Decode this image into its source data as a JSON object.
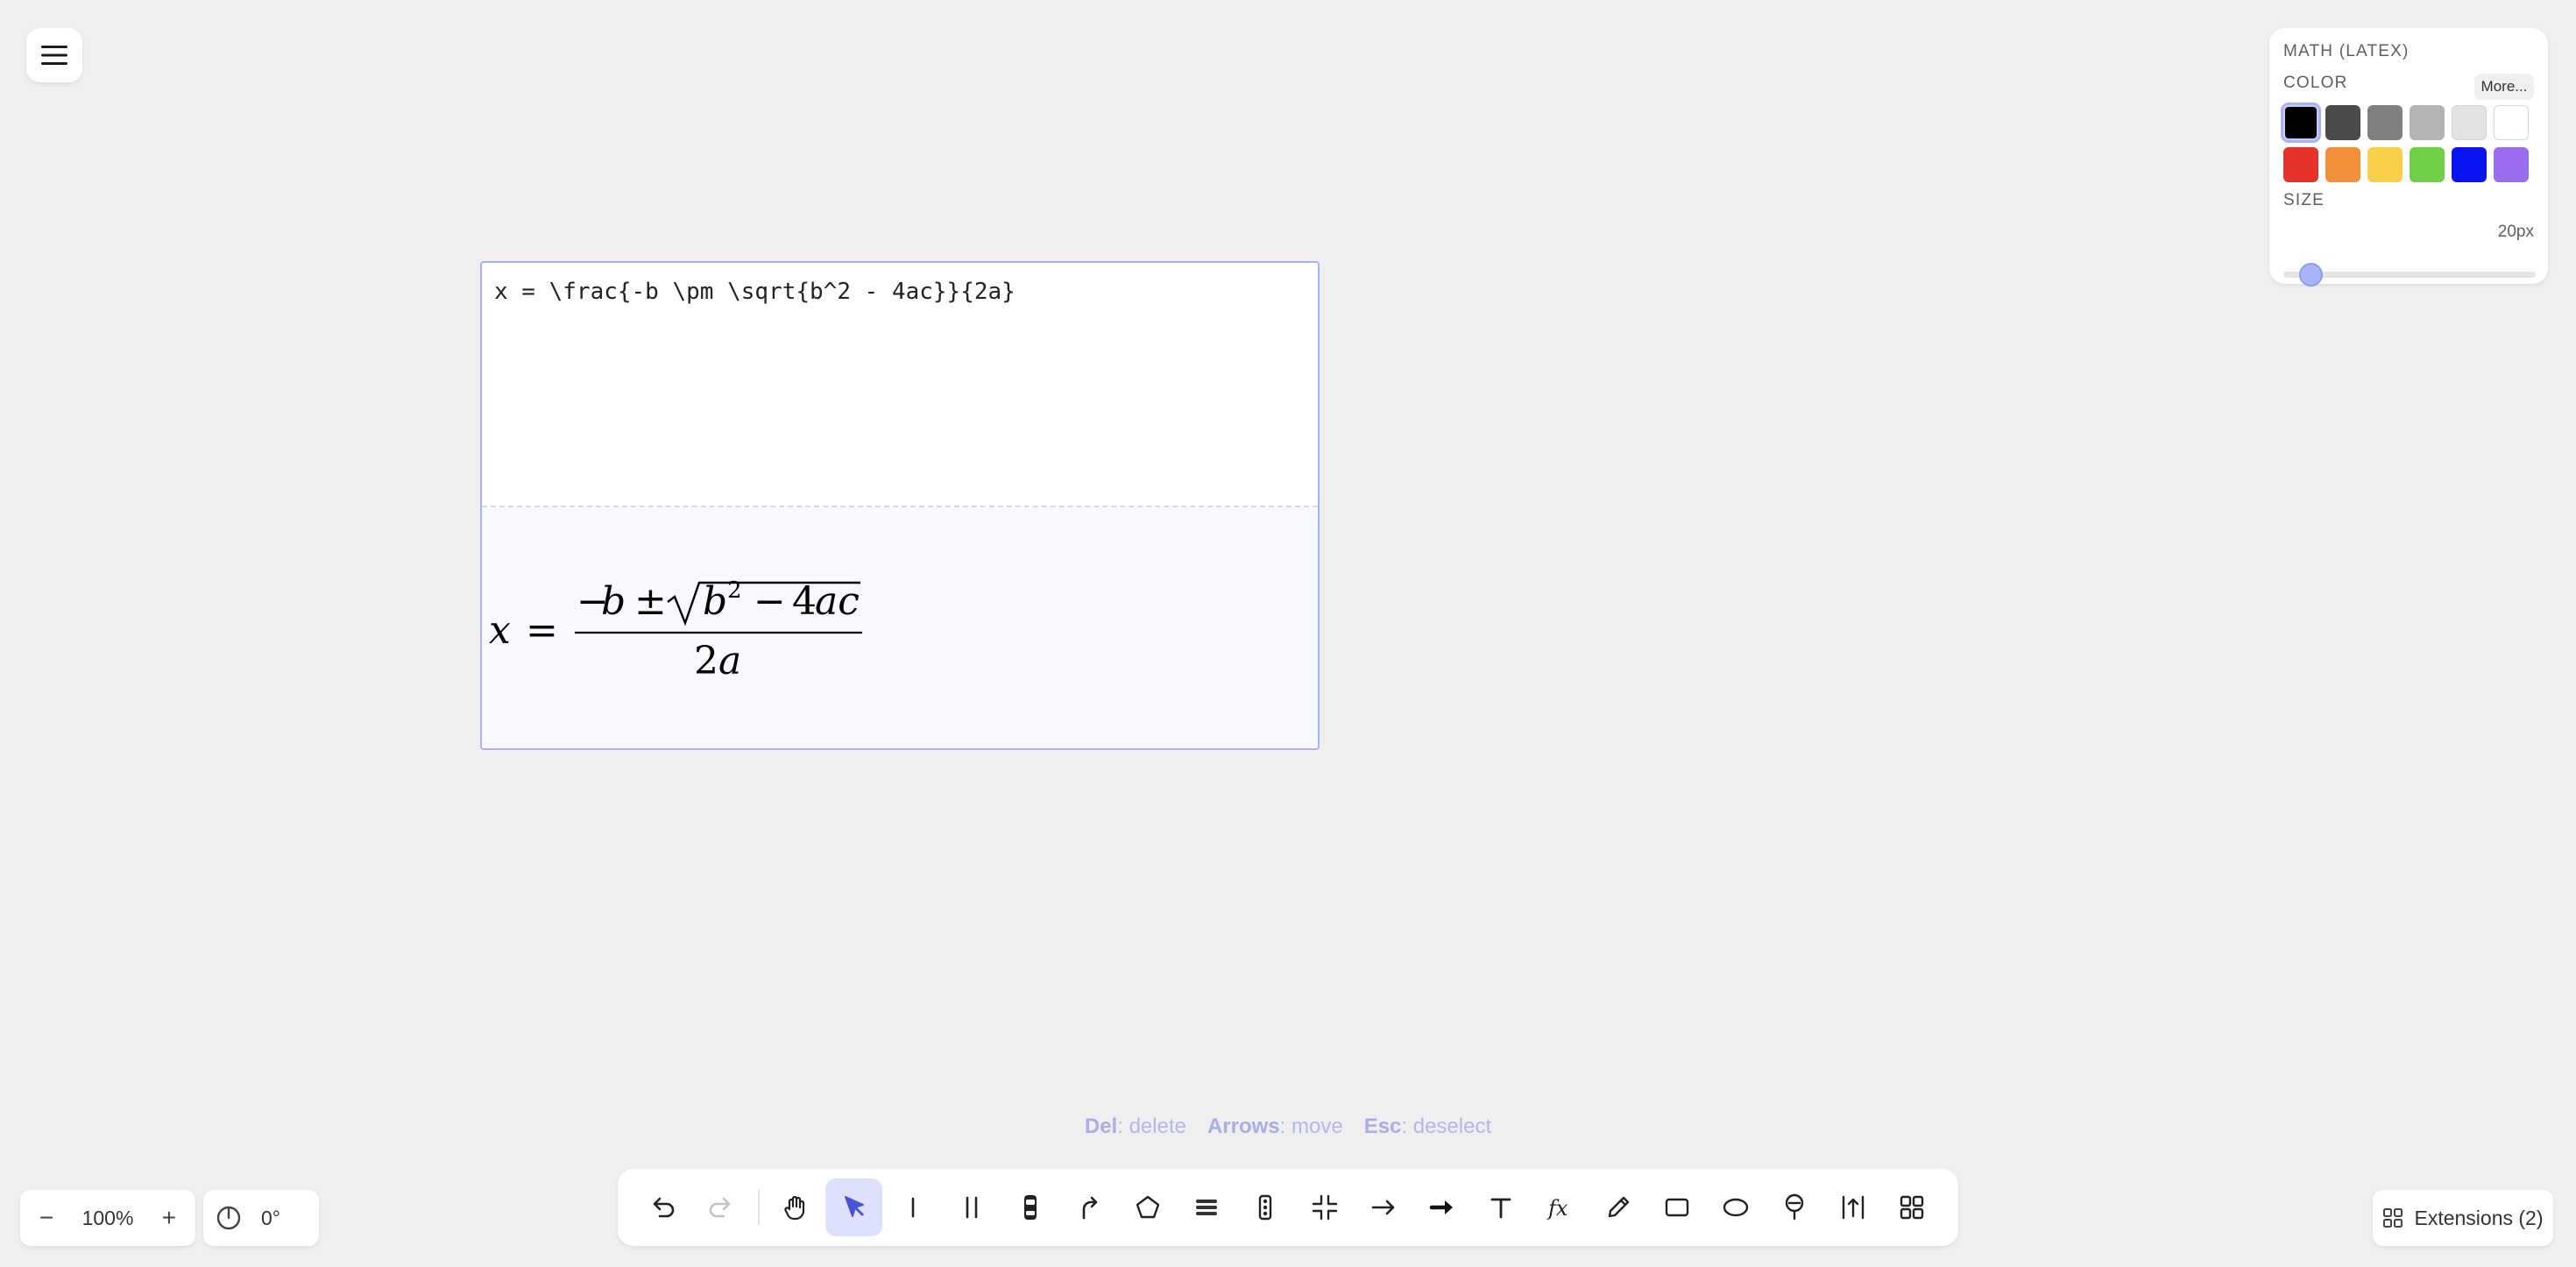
{
  "menu": {
    "icon": "hamburger-menu-icon"
  },
  "properties": {
    "title": "MATH (LATEX)",
    "color_label": "COLOR",
    "more_label": "More...",
    "colors_row1": [
      "#000000",
      "#4a4a4a",
      "#808080",
      "#b3b3b3",
      "#e3e3e3",
      "#ffffff"
    ],
    "colors_row2": [
      "#e6332a",
      "#f18f3a",
      "#f7cf48",
      "#6fcf46",
      "#0a14f0",
      "#9a6cf0"
    ],
    "selected_color": "#000000",
    "size_label": "SIZE",
    "size_value": "20px",
    "size_fraction": 0.11
  },
  "math": {
    "latex_source": "x = \\frac{-b \\pm \\sqrt{b^2 - 4ac}}{2a}",
    "rendered": {
      "lhs": "x",
      "equals": "=",
      "numerator_minus": "−",
      "numerator_b": "b",
      "pm": "±",
      "sqrt_b": "b",
      "exponent": "2",
      "sqrt_minus": "−",
      "sqrt_4": "4",
      "sqrt_ac": "ac",
      "denominator_2": "2",
      "denominator_a": "a"
    }
  },
  "hint": {
    "del_key": "Del",
    "del_action": ": delete",
    "arrows_key": "Arrows",
    "arrows_action": ": move",
    "esc_key": "Esc",
    "esc_action": ": deselect"
  },
  "zoom": {
    "minus": "−",
    "level": "100%",
    "plus": "+"
  },
  "rotation": {
    "value": "0°"
  },
  "toolbar": {
    "tools": [
      "undo-icon",
      "redo-icon",
      "hand-pan-icon",
      "select-pointer-icon",
      "single-line-icon",
      "double-line-icon",
      "vehicle-icon",
      "curved-arrow-icon",
      "polygon-icon",
      "lanes-icon",
      "traffic-light-icon",
      "merge-icon",
      "arrow-icon",
      "bold-arrow-icon",
      "text-icon",
      "math-fx-icon",
      "pencil-icon",
      "rectangle-icon",
      "ellipse-icon",
      "marker-pin-icon",
      "measure-icon",
      "grid-apps-icon"
    ],
    "active_tool": "select-pointer-icon",
    "fx_label": "fx",
    "text_label": "T"
  },
  "extensions": {
    "label": "Extensions (2)",
    "icon": "grid-icon"
  }
}
